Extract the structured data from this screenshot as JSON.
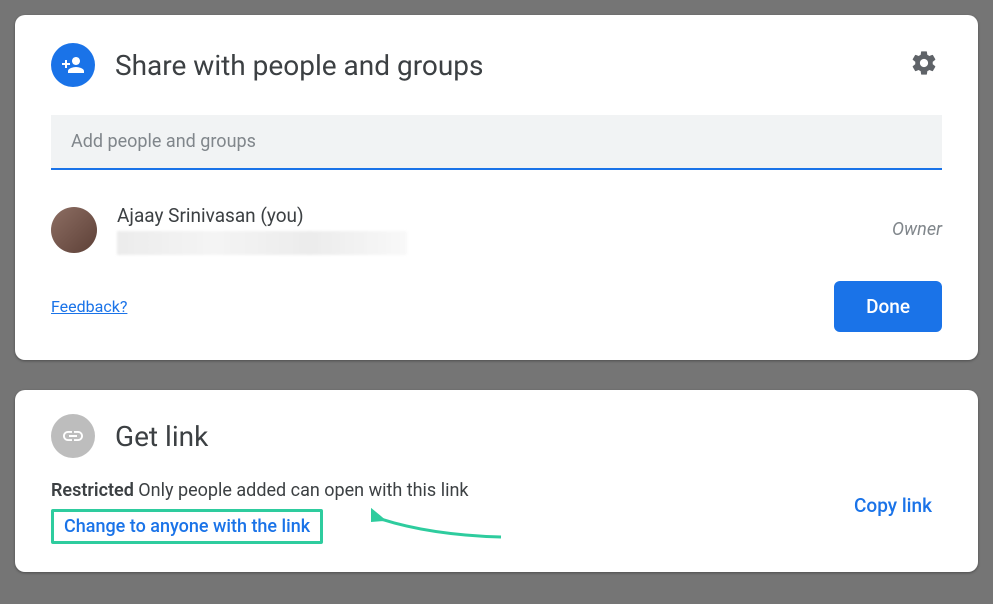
{
  "share": {
    "title": "Share with people and groups",
    "input_placeholder": "Add people and groups",
    "user": {
      "name": "Ajaay Srinivasan (you)",
      "role": "Owner"
    },
    "feedback_label": "Feedback?",
    "done_label": "Done"
  },
  "link": {
    "title": "Get link",
    "restricted_label": "Restricted",
    "restricted_desc": " Only people added can open with this link",
    "change_label": "Change to anyone with the link",
    "copy_label": "Copy link"
  }
}
